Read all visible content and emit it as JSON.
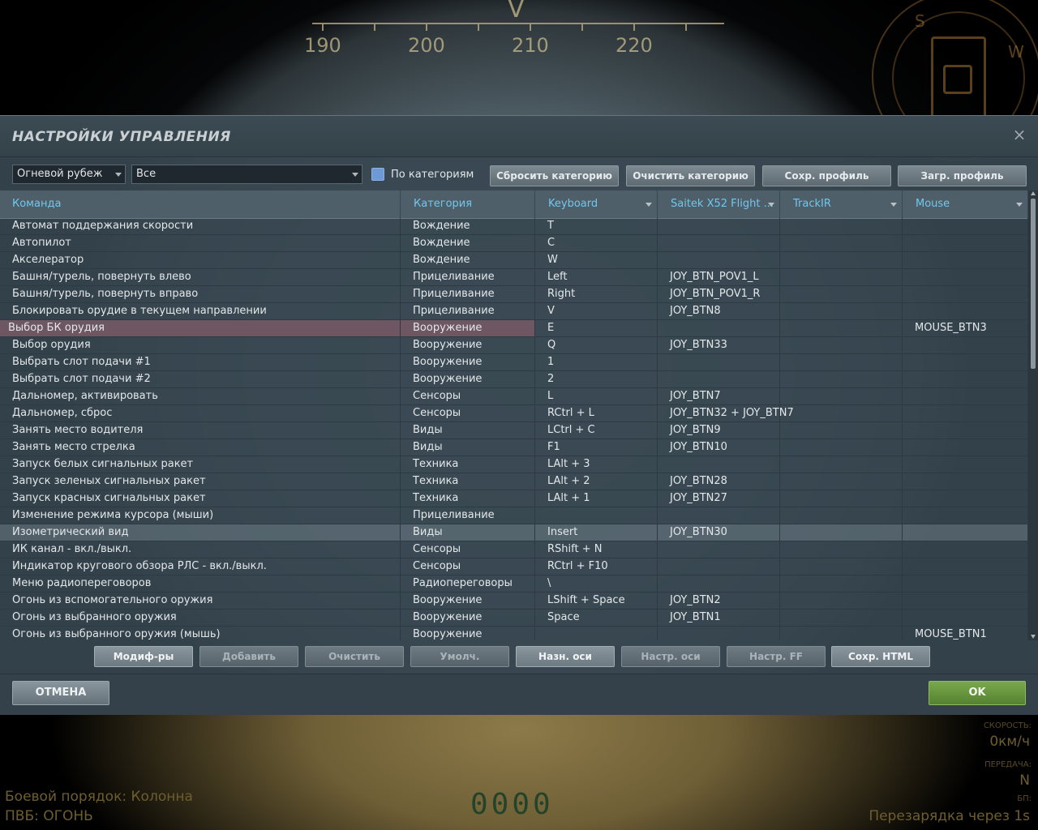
{
  "hud": {
    "compass_ticks": [
      "190",
      "200",
      "210",
      "220"
    ],
    "compass_marker": "V",
    "compass_letters": [
      "S",
      "W"
    ],
    "formation": "Боевой порядок: Колонна",
    "air_defense": "ПВБ: ОГОНЬ",
    "counter": "0000",
    "speed_label": "СКОРОСТЬ:",
    "speed_value": "0км/ч",
    "gear_label": "ПЕРЕДАЧА:",
    "gear_value": "N",
    "ammo_label": "БП:",
    "reload_text": "Перезарядка через 1s"
  },
  "dialog": {
    "title": "НАСТРОЙКИ УПРАВЛЕНИЯ",
    "close_symbol": "×",
    "profile_select": "Огневой рубеж",
    "category_select": "Все",
    "by_category_label": "По категориям",
    "toolbar": {
      "reset_category": "Сбросить категорию",
      "clear_category": "Очистить категорию",
      "save_profile": "Сохр. профиль",
      "load_profile": "Загр. профиль"
    },
    "columns": [
      "Команда",
      "Категория",
      "Keyboard",
      "Saitek X52 Flight ...",
      "TrackIR",
      "Mouse"
    ],
    "rows": [
      [
        "Автомат поддержания скорости",
        "Вождение",
        "T",
        "",
        "",
        ""
      ],
      [
        "Автопилот",
        "Вождение",
        "C",
        "",
        "",
        ""
      ],
      [
        "Акселератор",
        "Вождение",
        "W",
        "",
        "",
        ""
      ],
      [
        "Башня/турель, повернуть влево",
        "Прицеливание",
        "Left",
        "JOY_BTN_POV1_L",
        "",
        ""
      ],
      [
        "Башня/турель, повернуть вправо",
        "Прицеливание",
        "Right",
        "JOY_BTN_POV1_R",
        "",
        ""
      ],
      [
        "Блокировать орудие в текущем направлении",
        "Прицеливание",
        "V",
        "JOY_BTN8",
        "",
        ""
      ],
      [
        "Выбор БК орудия",
        "Вооружение",
        "E",
        "",
        "",
        "MOUSE_BTN3"
      ],
      [
        "Выбор орудия",
        "Вооружение",
        "Q",
        "JOY_BTN33",
        "",
        ""
      ],
      [
        "Выбрать слот подачи #1",
        "Вооружение",
        "1",
        "",
        "",
        ""
      ],
      [
        "Выбрать слот подачи #2",
        "Вооружение",
        "2",
        "",
        "",
        ""
      ],
      [
        "Дальномер, активировать",
        "Сенсоры",
        "L",
        "JOY_BTN7",
        "",
        ""
      ],
      [
        "Дальномер, сброс",
        "Сенсоры",
        "RCtrl + L",
        "JOY_BTN32 + JOY_BTN7",
        "",
        ""
      ],
      [
        "Занять место водителя",
        "Виды",
        "LCtrl + C",
        "JOY_BTN9",
        "",
        ""
      ],
      [
        "Занять место стрелка",
        "Виды",
        "F1",
        "JOY_BTN10",
        "",
        ""
      ],
      [
        "Запуск белых сигнальных ракет",
        "Техника",
        "LAlt + 3",
        "",
        "",
        ""
      ],
      [
        "Запуск зеленых сигнальных ракет",
        "Техника",
        "LAlt + 2",
        "JOY_BTN28",
        "",
        ""
      ],
      [
        "Запуск красных сигнальных ракет",
        "Техника",
        "LAlt + 1",
        "JOY_BTN27",
        "",
        ""
      ],
      [
        "Изменение режима курсора (мыши)",
        "Прицеливание",
        "",
        "",
        "",
        ""
      ],
      [
        "Изометрический вид",
        "Виды",
        "Insert",
        "JOY_BTN30",
        "",
        ""
      ],
      [
        "ИК канал - вкл./выкл.",
        "Сенсоры",
        "RShift + N",
        "",
        "",
        ""
      ],
      [
        "Индикатор кругового обзора РЛС - вкл./выкл.",
        "Сенсоры",
        "RCtrl + F10",
        "",
        "",
        ""
      ],
      [
        "Меню радиопереговоров",
        "Радиопереговоры",
        "\\",
        "",
        "",
        ""
      ],
      [
        "Огонь из вспомогательного оружия",
        "Вооружение",
        "LShift + Space",
        "JOY_BTN2",
        "",
        ""
      ],
      [
        "Огонь из выбранного оружия",
        "Вооружение",
        "Space",
        "JOY_BTN1",
        "",
        ""
      ],
      [
        "Огонь из выбранного оружия (мышь)",
        "Вооружение",
        "",
        "",
        "",
        "MOUSE_BTN1"
      ]
    ],
    "highlighted_row": 6,
    "selected_row": 18,
    "bottom_buttons": [
      "Модиф-ры",
      "Добавить",
      "Очистить",
      "Умолч.",
      "Назн. оси",
      "Настр. оси",
      "Настр. FF",
      "Сохр. HTML"
    ],
    "cancel": "ОТМЕНА",
    "ok": "OK"
  }
}
